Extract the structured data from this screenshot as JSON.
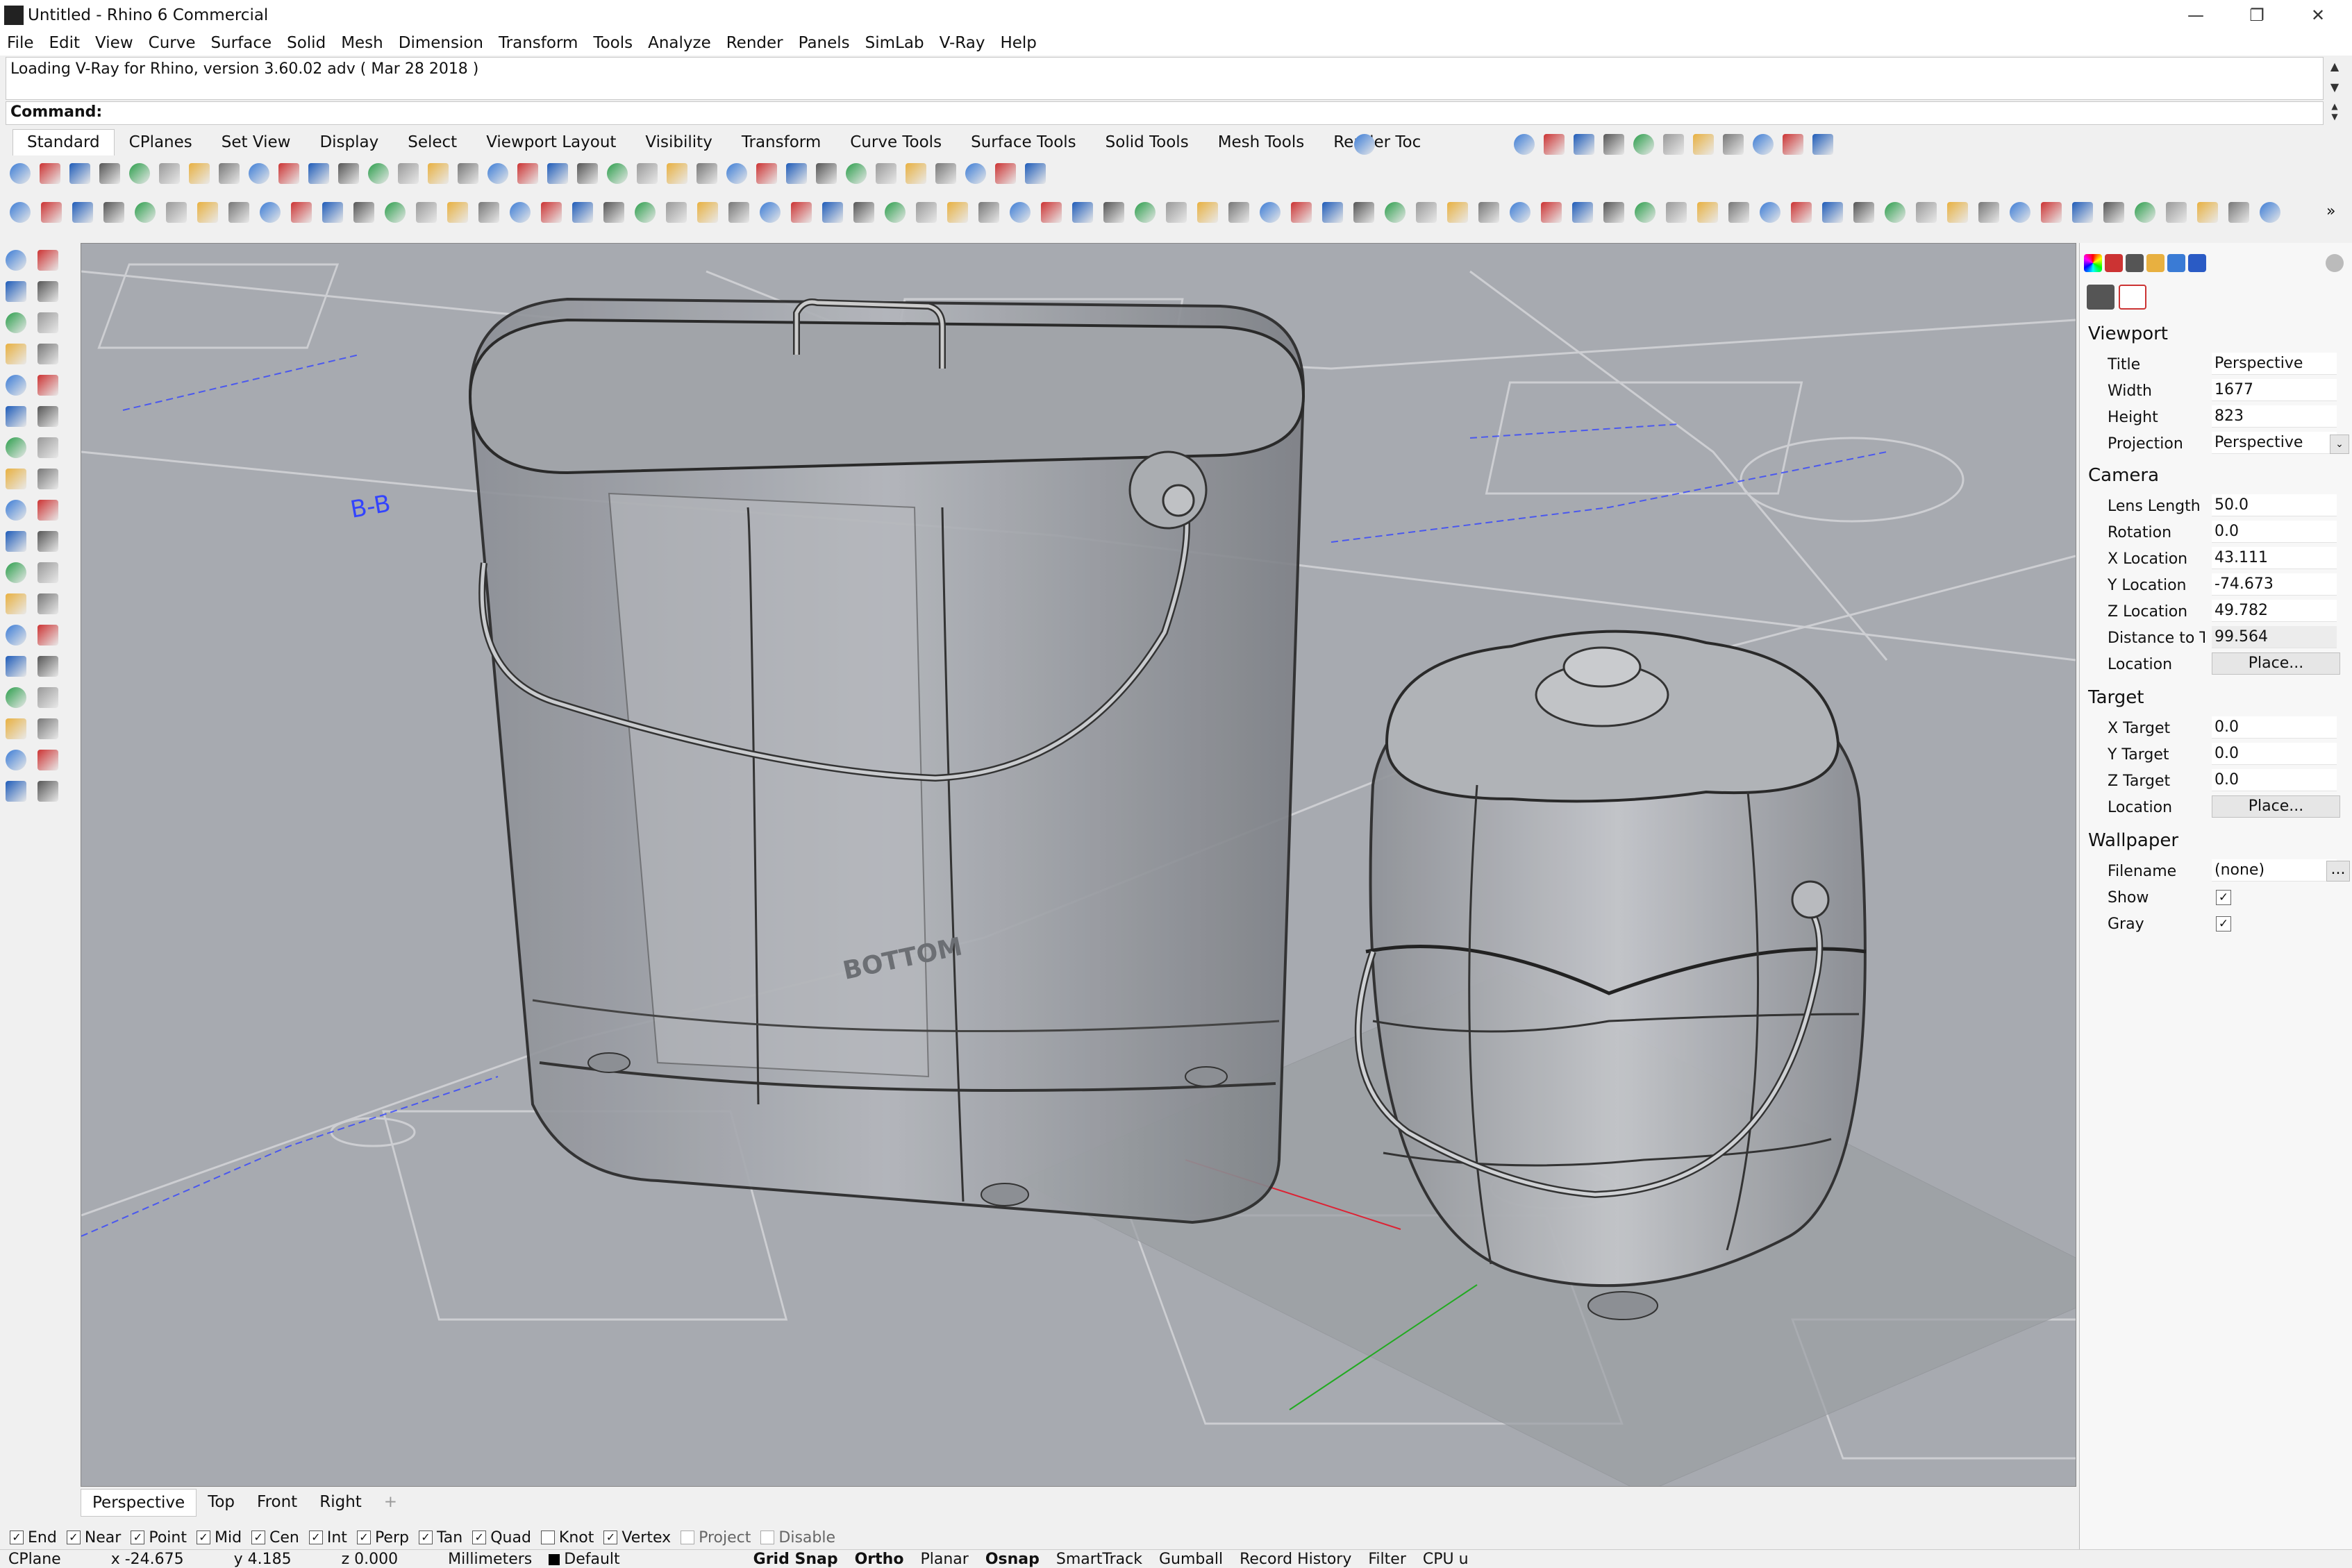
{
  "window": {
    "title": "Untitled - Rhino 6 Commercial",
    "minimize": "—",
    "restore": "❐",
    "close": "✕"
  },
  "menu": [
    "File",
    "Edit",
    "View",
    "Curve",
    "Surface",
    "Solid",
    "Mesh",
    "Dimension",
    "Transform",
    "Tools",
    "Analyze",
    "Render",
    "Panels",
    "SimLab",
    "V-Ray",
    "Help"
  ],
  "command": {
    "history": "Loading V-Ray for Rhino, version 3.60.02 adv ( Mar 28 2018 )",
    "prompt_label": "Command:",
    "input_value": ""
  },
  "toolbar_tabs": [
    "Standard",
    "CPlanes",
    "Set View",
    "Display",
    "Select",
    "Viewport Layout",
    "Visibility",
    "Transform",
    "Curve Tools",
    "Surface Tools",
    "Solid Tools",
    "Mesh Tools",
    "Render Toc"
  ],
  "viewport": {
    "label_bottom": "BOTTOM",
    "decal_text": "B-B"
  },
  "viewport_tabs": [
    "Perspective",
    "Top",
    "Front",
    "Right",
    "+"
  ],
  "osnaps": [
    {
      "label": "End",
      "checked": true
    },
    {
      "label": "Near",
      "checked": true
    },
    {
      "label": "Point",
      "checked": true
    },
    {
      "label": "Mid",
      "checked": true
    },
    {
      "label": "Cen",
      "checked": true
    },
    {
      "label": "Int",
      "checked": true
    },
    {
      "label": "Perp",
      "checked": true
    },
    {
      "label": "Tan",
      "checked": true
    },
    {
      "label": "Quad",
      "checked": true
    },
    {
      "label": "Knot",
      "checked": false
    },
    {
      "label": "Vertex",
      "checked": true
    },
    {
      "label": "Project",
      "checked": false
    },
    {
      "label": "Disable",
      "checked": false
    }
  ],
  "status": {
    "cplane": "CPlane",
    "x": "x -24.675",
    "y": "y 4.185",
    "z": "z 0.000",
    "units": "Millimeters",
    "layer": "Default",
    "grid_snap": "Grid Snap",
    "ortho": "Ortho",
    "planar": "Planar",
    "osnap": "Osnap",
    "smarttrack": "SmartTrack",
    "gumball": "Gumball",
    "record_history": "Record History",
    "filter": "Filter",
    "cpu": "CPU u"
  },
  "properties": {
    "viewport_header": "Viewport",
    "title_k": "Title",
    "title_v": "Perspective",
    "width_k": "Width",
    "width_v": "1677",
    "height_k": "Height",
    "height_v": "823",
    "projection_k": "Projection",
    "projection_v": "Perspective",
    "camera_header": "Camera",
    "lens_k": "Lens Length",
    "lens_v": "50.0",
    "rotation_k": "Rotation",
    "rotation_v": "0.0",
    "xloc_k": "X Location",
    "xloc_v": "43.111",
    "yloc_k": "Y Location",
    "yloc_v": "-74.673",
    "zloc_k": "Z Location",
    "zloc_v": "49.782",
    "dist_k": "Distance to T...",
    "dist_v": "99.564",
    "camloc_k": "Location",
    "camloc_btn": "Place...",
    "target_header": "Target",
    "xt_k": "X Target",
    "xt_v": "0.0",
    "yt_k": "Y Target",
    "yt_v": "0.0",
    "zt_k": "Z Target",
    "zt_v": "0.0",
    "tloc_k": "Location",
    "tloc_btn": "Place...",
    "wallpaper_header": "Wallpaper",
    "filename_k": "Filename",
    "filename_v": "(none)",
    "filename_btn": "...",
    "show_k": "Show",
    "gray_k": "Gray",
    "check_mark": "✓"
  }
}
